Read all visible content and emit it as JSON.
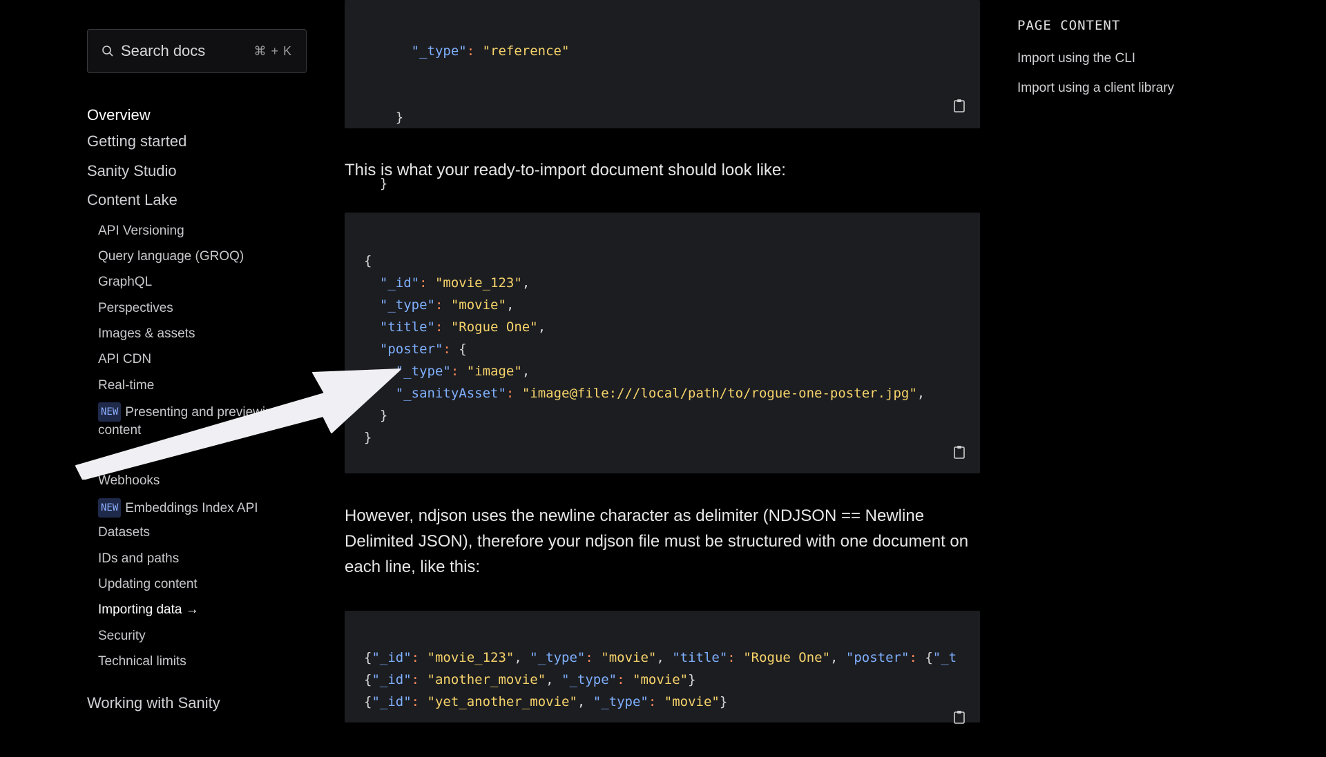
{
  "search": {
    "placeholder": "Search docs",
    "shortcut": "⌘ + K"
  },
  "nav": {
    "top": [
      {
        "label": "Overview",
        "active": true
      },
      {
        "label": "Getting started"
      },
      {
        "label": "Sanity Studio"
      },
      {
        "label": "Content Lake"
      }
    ],
    "content_lake": [
      {
        "label": "API Versioning"
      },
      {
        "label": "Query language (GROQ)"
      },
      {
        "label": "GraphQL"
      },
      {
        "label": "Perspectives"
      },
      {
        "label": "Images & assets"
      },
      {
        "label": "API CDN"
      },
      {
        "label": "Real-time"
      },
      {
        "badge": "NEW",
        "label": "Presenting and previewing content"
      },
      {
        "label": "Webhooks"
      },
      {
        "badge": "NEW",
        "label": "Embeddings Index API"
      },
      {
        "label": "Datasets"
      },
      {
        "label": "IDs and paths"
      },
      {
        "label": "Updating content"
      },
      {
        "label": "Importing data →",
        "current": true
      },
      {
        "label": "Security"
      },
      {
        "label": "Technical limits"
      }
    ],
    "bottom": {
      "label": "Working with Sanity"
    }
  },
  "toc": {
    "title": "PAGE CONTENT",
    "items": [
      "Import using the CLI",
      "Import using a client library"
    ]
  },
  "code1_lines": [
    "      \"_type\": \"reference\"",
    "    }",
    "  }",
    "}"
  ],
  "para1": "This is what your ready-to-import document should look like:",
  "code2_lines": [
    "{",
    "  \"_id\": \"movie_123\",",
    "  \"_type\": \"movie\",",
    "  \"title\": \"Rogue One\",",
    "  \"poster\": {",
    "    \"_type\": \"image\",",
    "    \"_sanityAsset\": \"image@file:///local/path/to/rogue-one-poster.jpg\",",
    "  }",
    "}"
  ],
  "para2": "However, ndjson uses the newline character as delimiter (NDJSON == Newline Delimited JSON), therefore your ndjson file must be structured with one document on each line, like this:",
  "code3_lines": [
    "{\"_id\": \"movie_123\", \"_type\": \"movie\", \"title\": \"Rogue One\", \"poster\": {\"_t",
    "{\"_id\": \"another_movie\", \"_type\": \"movie\"}",
    "{\"_id\": \"yet_another_movie\", \"_type\": \"movie\"}"
  ],
  "colors": {
    "key": "#7fb0ff",
    "string": "#f6d36a",
    "punct": "#ff8a5a",
    "code_bg": "#1c1d21"
  }
}
